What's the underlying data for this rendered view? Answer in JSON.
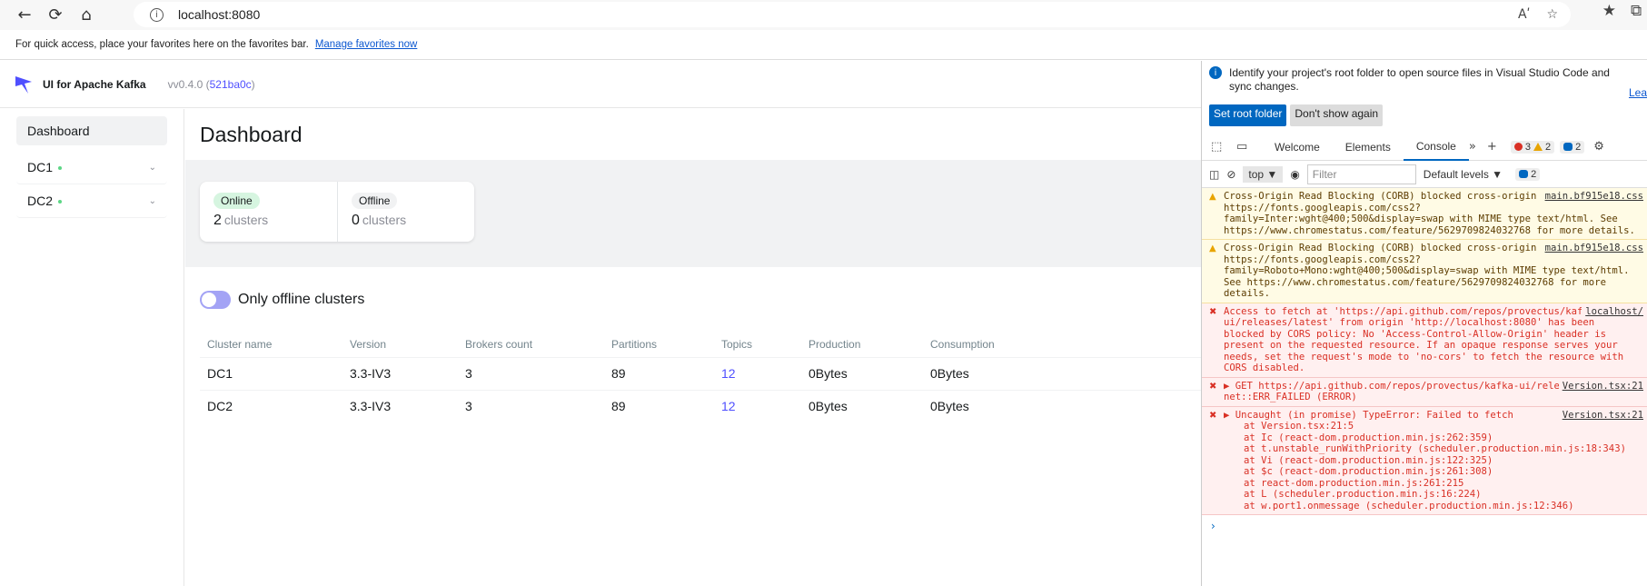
{
  "browser": {
    "url": "localhost:8080",
    "favorites_text": "For quick access, place your favorites here on the favorites bar.",
    "favorites_link": "Manage favorites now",
    "read_aloud": "Aʹ"
  },
  "app": {
    "brand": "UI for Apache Kafka",
    "version_prefix": "vv0.4.0 (",
    "version_hash": "521ba0c",
    "version_suffix": ")"
  },
  "sidebar": {
    "items": [
      {
        "label": "Dashboard"
      },
      {
        "label": "DC1"
      },
      {
        "label": "DC2"
      }
    ]
  },
  "main": {
    "title": "Dashboard",
    "metrics": [
      {
        "tag": "Online",
        "value": "2",
        "unit": "clusters"
      },
      {
        "tag": "Offline",
        "value": "0",
        "unit": "clusters"
      }
    ],
    "toggle_label": "Only offline clusters",
    "table": {
      "headers": [
        "Cluster name",
        "Version",
        "Brokers count",
        "Partitions",
        "Topics",
        "Production",
        "Consumption"
      ],
      "rows": [
        [
          "DC1",
          "3.3-IV3",
          "3",
          "89",
          "12",
          "0Bytes",
          "0Bytes"
        ],
        [
          "DC2",
          "3.3-IV3",
          "3",
          "89",
          "12",
          "0Bytes",
          "0Bytes"
        ]
      ]
    }
  },
  "devtools": {
    "info_text": "Identify your project's root folder to open source files in Visual Studio Code and sync changes.",
    "info_link": "Lea",
    "btn_set_root": "Set root folder",
    "btn_dont_show": "Don't show again",
    "tabs": [
      "Welcome",
      "Elements",
      "Console"
    ],
    "errors_count": "3",
    "warnings_count": "2",
    "messages_count": "2",
    "context": "top",
    "filter_placeholder": "Filter",
    "levels": "Default levels",
    "levels_count": "2",
    "messages": [
      {
        "src": "main.bf915e18.css",
        "text": "Cross-Origin Read Blocking (CORB) blocked cross-origin response https://fonts.googleapis.com/css2?family=Inter:wght@400;500&display=swap with MIME type text/html. See https://www.chromestatus.com/feature/5629709824032768 for more details."
      },
      {
        "src": "main.bf915e18.css",
        "text": "Cross-Origin Read Blocking (CORB) blocked cross-origin response https://fonts.googleapis.com/css2?family=Roboto+Mono:wght@400;500&display=swap with MIME type text/html. See https://www.chromestatus.com/feature/5629709824032768 for more details."
      },
      {
        "src": "localhost/",
        "text": "Access to fetch at 'https://api.github.com/repos/provectus/kafka-ui/releases/latest' from origin 'http://localhost:8080' has been blocked by CORS policy: No 'Access-Control-Allow-Origin' header is present on the requested resource. If an opaque response serves your needs, set the request's mode to 'no-cors' to fetch the resource with CORS disabled."
      },
      {
        "src": "Version.tsx:21",
        "text": "▶ GET https://api.github.com/repos/provectus/kafka-ui/releases/latest net::ERR_FAILED (ERROR)"
      },
      {
        "src": "Version.tsx:21",
        "text": "▶ Uncaught (in promise) TypeError: Failed to fetch"
      }
    ],
    "stack": [
      "at Version.tsx:21:5",
      "at Ic (react-dom.production.min.js:262:359)",
      "at t.unstable_runWithPriority (scheduler.production.min.js:18:343)",
      "at Vi (react-dom.production.min.js:122:325)",
      "at $c (react-dom.production.min.js:261:308)",
      "at react-dom.production.min.js:261:215",
      "at L (scheduler.production.min.js:16:224)",
      "at w.port1.onmessage (scheduler.production.min.js:12:346)"
    ]
  }
}
